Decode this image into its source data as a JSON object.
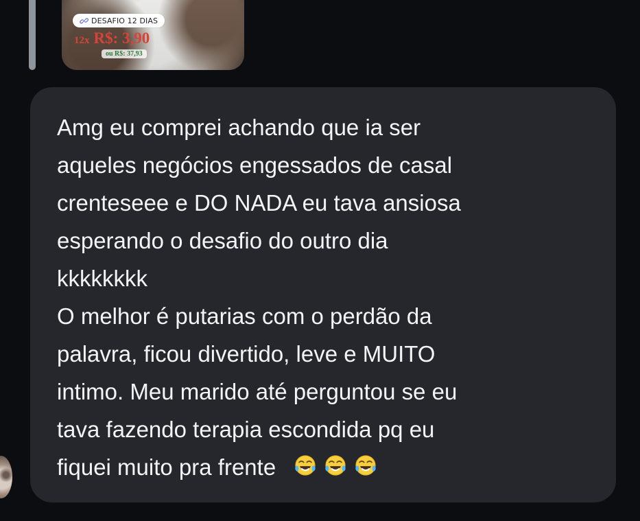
{
  "shared_post": {
    "badge_label": "DESAFIO 12 DIAS",
    "installments_label": "12x",
    "price_label": "R$: 3,90",
    "alt_price_label": "ou R$: 37,93",
    "badge_icon": "link-icon"
  },
  "message": {
    "lines": [
      "Amg eu comprei achando que ia ser",
      "aqueles negócios engessados de casal",
      "crenteseee e DO NADA eu tava ansiosa",
      "esperando o desafio do outro dia",
      "kkkkkkkk",
      "O melhor é putarias com o perdão da",
      "palavra, ficou divertido, leve e MUITO",
      "intimo. Meu marido até perguntou se eu",
      "tava fazendo terapia escondida pq eu",
      "fiquei muito pra frente"
    ],
    "emojis": [
      "face-with-tears-of-joy-icon",
      "face-with-tears-of-joy-icon",
      "face-with-tears-of-joy-icon"
    ]
  }
}
